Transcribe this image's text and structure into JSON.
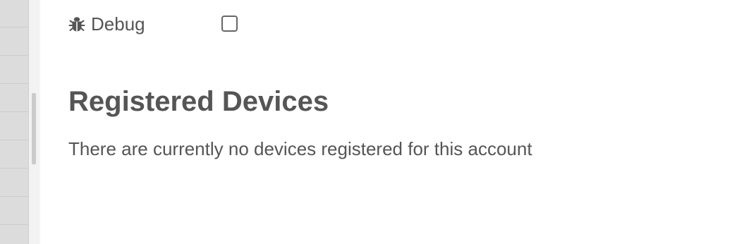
{
  "settings": {
    "debug": {
      "icon": "bug-icon",
      "label": "Debug",
      "checked": false
    }
  },
  "registered_devices": {
    "title": "Registered Devices",
    "empty_message": "There are currently no devices registered for this account"
  },
  "colors": {
    "text": "#555555",
    "background": "#ffffff",
    "side_panel": "#dcdcdc"
  }
}
